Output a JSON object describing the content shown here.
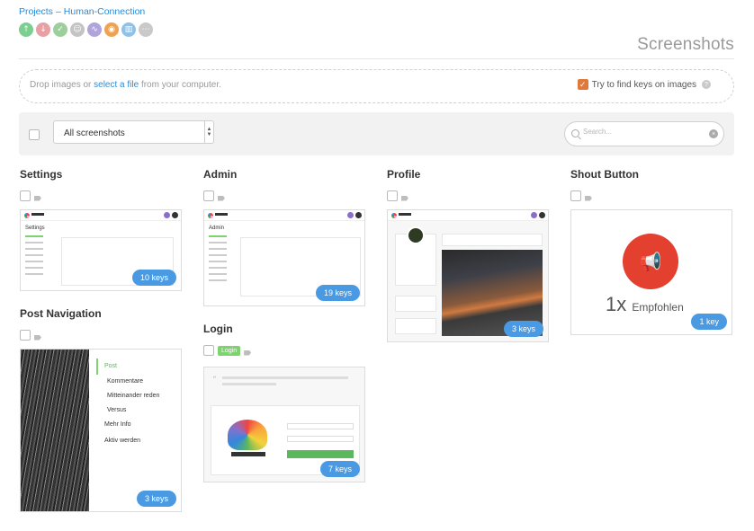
{
  "breadcrumb": {
    "projects": "Projects",
    "separator": "–",
    "project": "Human-Connection"
  },
  "status_icons": [
    {
      "name": "arrow-up-icon",
      "glyph": "↑",
      "color": "#7ccf8e"
    },
    {
      "name": "arrow-down-icon",
      "glyph": "↓",
      "color": "#e8a0a4"
    },
    {
      "name": "check-icon",
      "glyph": "✓",
      "color": "#9ccf9c"
    },
    {
      "name": "accessibility-icon",
      "glyph": "☺",
      "color": "#c4c4c4"
    },
    {
      "name": "activity-icon",
      "glyph": "∿",
      "color": "#b0a4dc"
    },
    {
      "name": "camera-icon",
      "glyph": "◉",
      "color": "#f0a250"
    },
    {
      "name": "book-icon",
      "glyph": "▥",
      "color": "#8fc2e6"
    },
    {
      "name": "more-icon",
      "glyph": "⋯",
      "color": "#c9c9c9"
    }
  ],
  "page_title": "Screenshots",
  "dropzone": {
    "text_before": "Drop images or ",
    "link": "select a file",
    "text_after": " from your computer.",
    "option_label": "Try to find keys on images",
    "option_checked": true
  },
  "filter": {
    "select_value": "All screenshots",
    "search_placeholder": "Search..."
  },
  "groups": {
    "settings": {
      "title": "Settings",
      "keys": "10 keys"
    },
    "admin": {
      "title": "Admin",
      "keys": "19 keys"
    },
    "profile": {
      "title": "Profile",
      "keys": "3 keys"
    },
    "shout": {
      "title": "Shout Button",
      "keys": "1 key",
      "big": "1x",
      "word": "Empfohlen"
    },
    "post_navigation": {
      "title": "Post Navigation",
      "keys": "3 keys",
      "menu": [
        "Post",
        "Kommentare",
        "Mitteinander reden",
        "Versus",
        "Mehr Info",
        "Aktiv werden"
      ]
    },
    "login": {
      "title": "Login",
      "tag": "Login",
      "keys": "7 keys"
    }
  },
  "accent_colors": {
    "link": "#2a8bd8",
    "keys_badge": "#4a9ae3",
    "checkbox": "#e07a3c",
    "shout": "#e3402f"
  }
}
